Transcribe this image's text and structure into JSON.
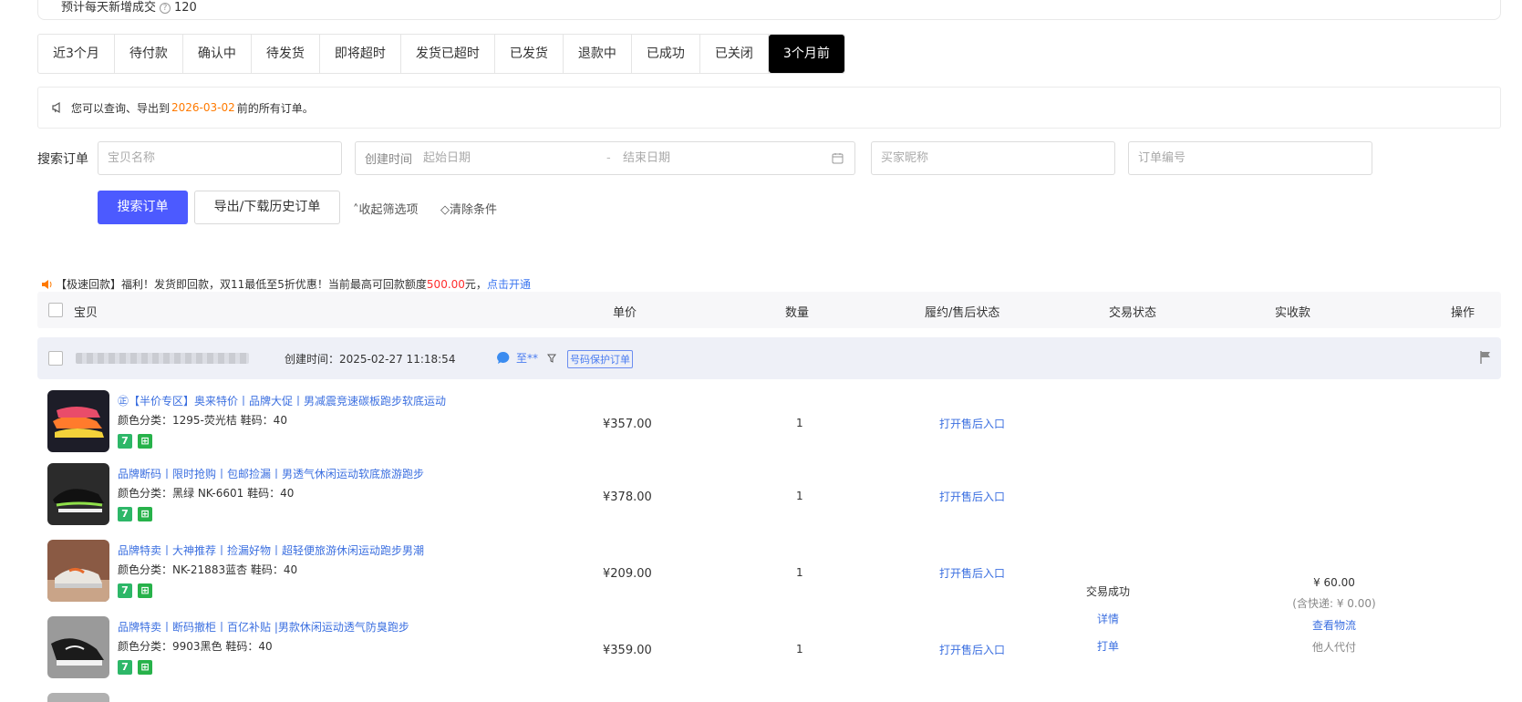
{
  "top_panel": {
    "estimate_label": "预计每天新增成交",
    "estimate_value": "120"
  },
  "tabs": [
    {
      "label": "近3个月",
      "active": false
    },
    {
      "label": "待付款",
      "active": false
    },
    {
      "label": "确认中",
      "active": false
    },
    {
      "label": "待发货",
      "active": false
    },
    {
      "label": "即将超时",
      "active": false
    },
    {
      "label": "发货已超时",
      "active": false
    },
    {
      "label": "已发货",
      "active": false
    },
    {
      "label": "退款中",
      "active": false
    },
    {
      "label": "已成功",
      "active": false
    },
    {
      "label": "已关闭",
      "active": false
    },
    {
      "label": "3个月前",
      "active": true
    }
  ],
  "notice": {
    "prefix": "您可以查询、导出到",
    "date": "2026-03-02",
    "suffix": "前的所有订单。"
  },
  "search": {
    "label": "搜索订单",
    "item_name_placeholder": "宝贝名称",
    "created_time_label": "创建时间",
    "start_date_placeholder": "起始日期",
    "date_separator": "-",
    "end_date_placeholder": "结束日期",
    "buyer_nick_placeholder": "买家昵称",
    "order_no_placeholder": "订单编号",
    "search_button": "搜索订单",
    "export_button": "导出/下载历史订单",
    "collapse_filters": "收起筛选项",
    "clear_conditions": "清除条件"
  },
  "promo": {
    "text_a": "【极速回款】福利！发货即回款，双11最低至5折优惠！当前最高可回款额度",
    "amount": "500.00",
    "text_b": "元，",
    "cta": "点击开通"
  },
  "table_header": {
    "item": "宝贝",
    "unit_price": "单价",
    "quantity": "数量",
    "fulfillment_status": "履约/售后状态",
    "trade_status": "交易状态",
    "received": "实收款",
    "actions": "操作"
  },
  "order": {
    "created_time": "创建时间：2025-02-27 11:18:54",
    "buyer": "至**",
    "protection_tag": "号码保护订单",
    "items": [
      {
        "title": "㊣【半价专区】奥来特价丨品牌大促丨男减震竞速碳板跑步软底运动",
        "spec": "颜色分类：1295-荧光桔  鞋码：40",
        "price": "¥357.00",
        "qty": "1",
        "after_sale": "打开售后入口"
      },
      {
        "title": "品牌断码丨限时抢购丨包邮捡漏丨男透气休闲运动软底旅游跑步",
        "spec": "颜色分类：黑绿 NK-6601  鞋码：40",
        "price": "¥378.00",
        "qty": "1",
        "after_sale": "打开售后入口"
      },
      {
        "title": "品牌特卖丨大神推荐丨捡漏好物丨超轻便旅游休闲运动跑步男潮",
        "spec": "颜色分类：NK-21883蓝杏  鞋码：40",
        "price": "¥209.00",
        "qty": "1",
        "after_sale": "打开售后入口"
      },
      {
        "title": "品牌特卖丨断码撤柜丨百亿补贴 |男款休闲运动透气防臭跑步",
        "spec": "颜色分类：9903黑色  鞋码：40",
        "price": "¥359.00",
        "qty": "1",
        "after_sale": "打开售后入口"
      }
    ],
    "trade_status": "交易成功",
    "detail_link": "详情",
    "print_link": "打单",
    "received_amount": "¥ 60.00",
    "shipping_note": "(含快递: ¥ 0.00)",
    "logistics_link": "查看物流",
    "payer_note": "他人代付"
  },
  "colors": {
    "primary": "#4c5aff",
    "link": "#3b6fe0",
    "date_orange": "#ff7a00",
    "amount_red": "#ff2d2d",
    "active_tab": "#000000"
  }
}
